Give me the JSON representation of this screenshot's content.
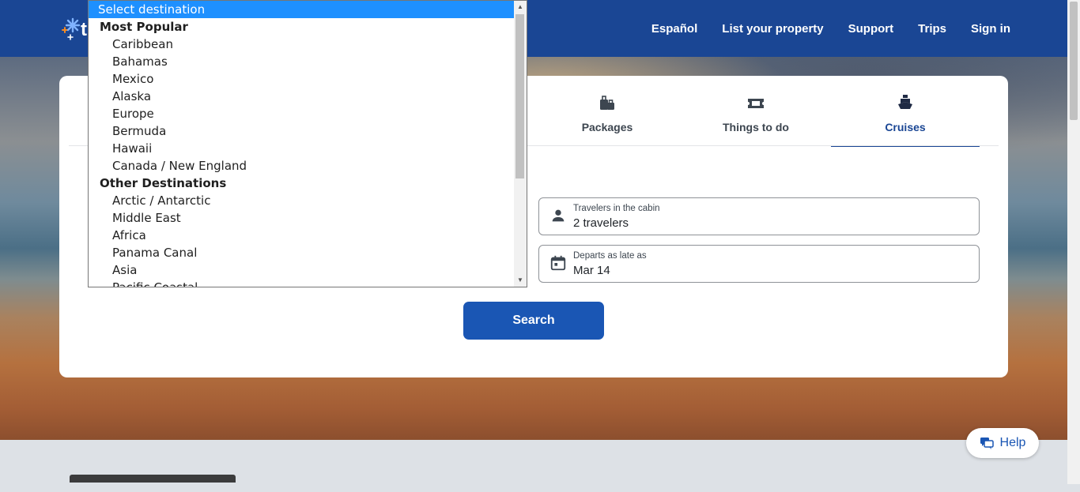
{
  "header": {
    "logo_letter": "t",
    "nav": [
      "Español",
      "List your property",
      "Support",
      "Trips",
      "Sign in"
    ]
  },
  "tabs": [
    {
      "label": "Packages",
      "icon": "packages-icon"
    },
    {
      "label": "Things to do",
      "icon": "ticket-icon"
    },
    {
      "label": "Cruises",
      "icon": "cruise-ship-icon",
      "active": true
    }
  ],
  "fields": {
    "travelers": {
      "label": "Travelers in the cabin",
      "value": "2 travelers"
    },
    "departs": {
      "label": "Departs as late as",
      "value": "Mar 14"
    }
  },
  "search_label": "Search",
  "help_label": "Help",
  "dropdown": {
    "selected": "Select destination",
    "groups": [
      {
        "label": "Most Popular",
        "options": [
          "Caribbean",
          "Bahamas",
          "Mexico",
          "Alaska",
          "Europe",
          "Bermuda",
          "Hawaii",
          "Canada / New England"
        ]
      },
      {
        "label": "Other Destinations",
        "options": [
          "Arctic / Antarctic",
          "Middle East",
          "Africa",
          "Panama Canal",
          "Asia",
          "Pacific Coastal"
        ]
      }
    ]
  },
  "colors": {
    "brand": "#1a4694",
    "button": "#1a56b4",
    "select_highlight": "#1e90ff"
  }
}
